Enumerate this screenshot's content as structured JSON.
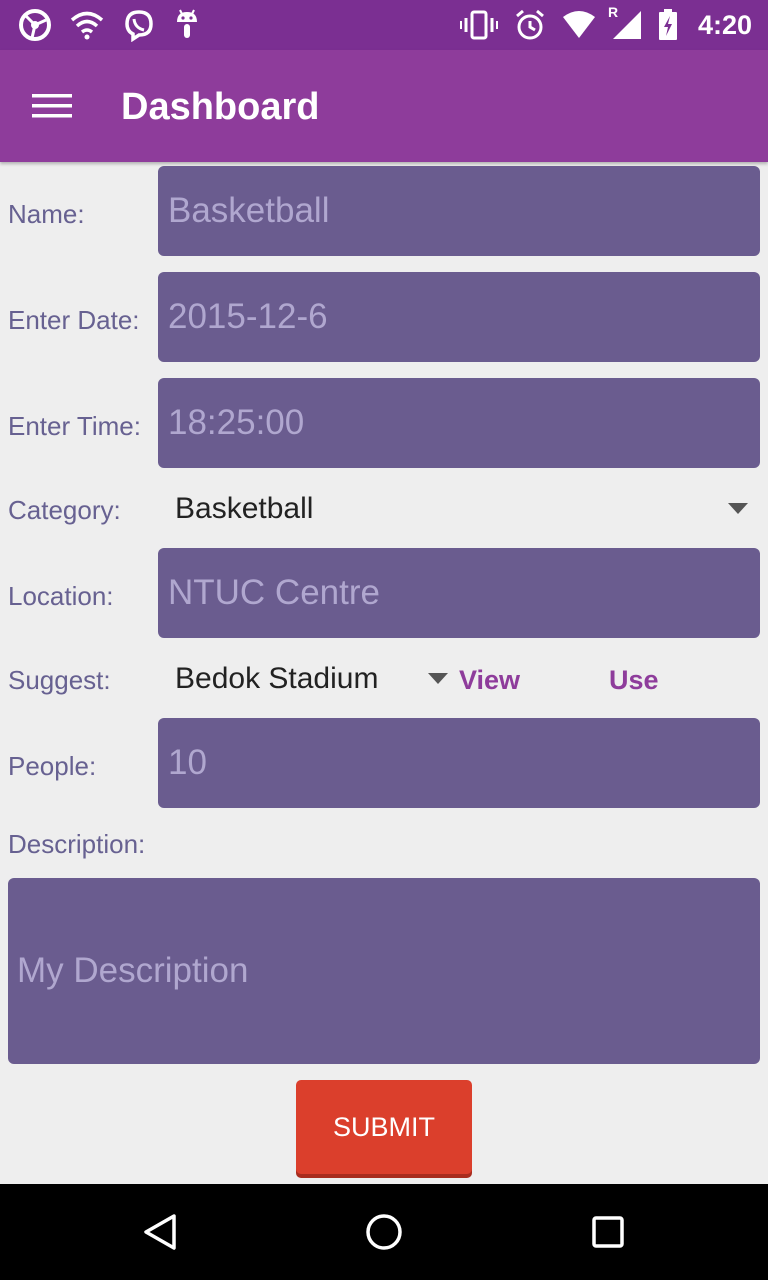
{
  "status_bar": {
    "time": "4:20",
    "left_icons": [
      "steering-wheel-icon",
      "wifi-icon",
      "viber-icon",
      "android-icon"
    ],
    "right_icons": [
      "vibrate-icon",
      "alarm-icon",
      "wifi-signal-icon",
      "cell-signal-roaming-icon",
      "battery-charging-icon"
    ],
    "roaming_indicator": "R"
  },
  "app_bar": {
    "title": "Dashboard",
    "menu_icon": "hamburger-menu-icon"
  },
  "form": {
    "name": {
      "label": "Name:",
      "value": "Basketball"
    },
    "date": {
      "label": "Enter Date:",
      "value": "2015-12-6"
    },
    "time": {
      "label": "Enter Time:",
      "value": "18:25:00"
    },
    "category": {
      "label": "Category:",
      "selected": "Basketball"
    },
    "location": {
      "label": "Location:",
      "value": "NTUC Centre"
    },
    "suggest": {
      "label": "Suggest:",
      "selected": "Bedok Stadium",
      "view_label": "View",
      "use_label": "Use"
    },
    "people": {
      "label": "People:",
      "value": "10"
    },
    "description": {
      "label": "Description:",
      "placeholder": "My Description"
    },
    "submit_label": "SUBMIT"
  },
  "nav_bar": {
    "buttons": [
      "back-icon",
      "home-icon",
      "recents-icon"
    ]
  },
  "colors": {
    "status_bar": "#7b2f92",
    "app_bar": "#8e3c9b",
    "field_bg": "#6a5c8f",
    "field_text": "#b0a7cf",
    "label_text": "#676191",
    "submit_bg": "#db3f2c",
    "accent": "#8e3c9b"
  }
}
